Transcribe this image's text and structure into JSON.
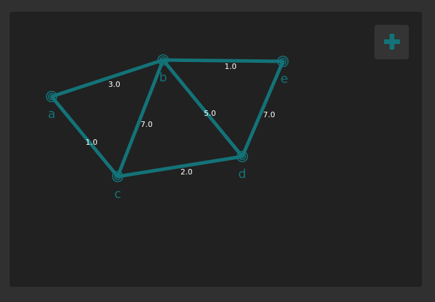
{
  "graph": {
    "nodes": [
      {
        "id": "a",
        "label": "a"
      },
      {
        "id": "b",
        "label": "b"
      },
      {
        "id": "c",
        "label": "c"
      },
      {
        "id": "d",
        "label": "d"
      },
      {
        "id": "e",
        "label": "e"
      }
    ],
    "edges": [
      {
        "from": "a",
        "to": "b",
        "weight": "3.0"
      },
      {
        "from": "a",
        "to": "c",
        "weight": "1.0"
      },
      {
        "from": "b",
        "to": "c",
        "weight": "7.0"
      },
      {
        "from": "b",
        "to": "d",
        "weight": "5.0"
      },
      {
        "from": "b",
        "to": "e",
        "weight": "1.0"
      },
      {
        "from": "c",
        "to": "d",
        "weight": "2.0"
      },
      {
        "from": "d",
        "to": "e",
        "weight": "7.0"
      }
    ]
  },
  "toolbar": {
    "add_button_icon": "plus-icon"
  },
  "colors": {
    "accent": "#137378",
    "panel_background": "#212121",
    "page_background": "#2f302f",
    "label_text": "#ffffff"
  }
}
